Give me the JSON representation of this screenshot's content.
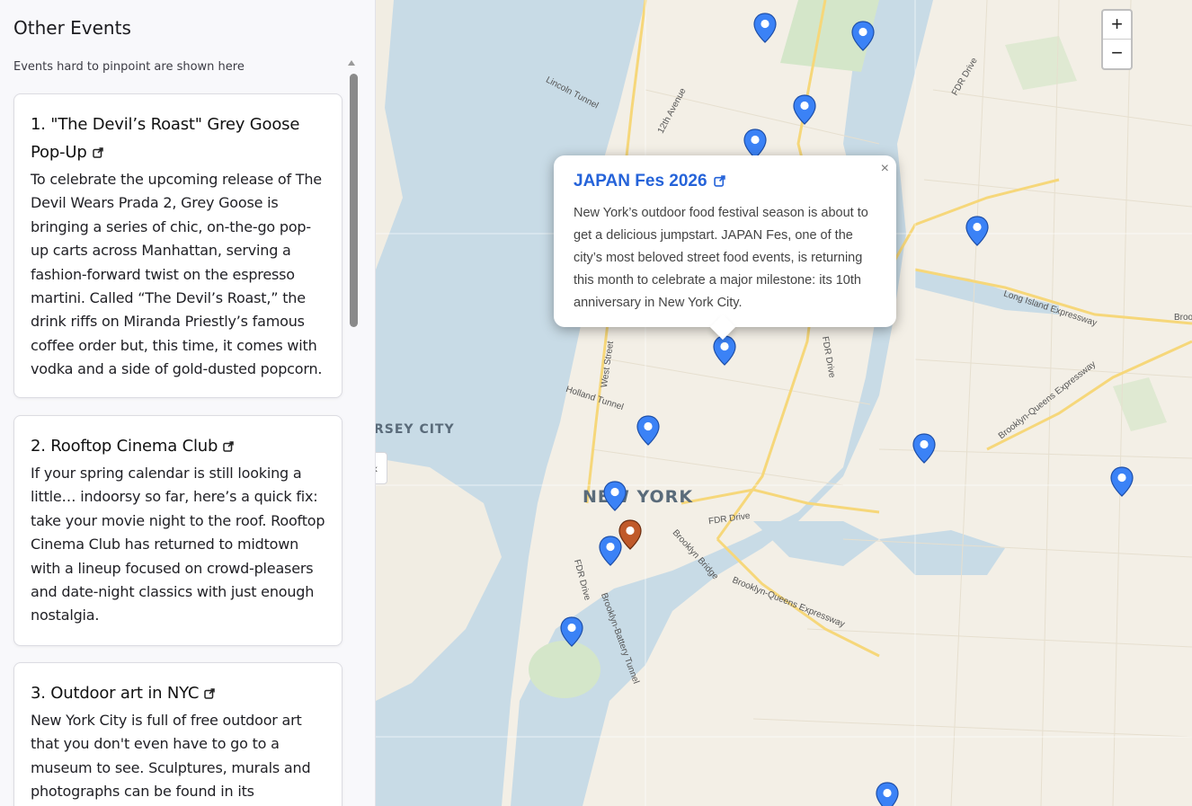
{
  "sidebar": {
    "title": "Other Events",
    "subtitle": "Events hard to pinpoint are shown here",
    "events": [
      {
        "title": "1. \"The Devil’s Roast\" Grey Goose Pop-Up",
        "body": "To celebrate the upcoming release of The Devil Wears Prada 2, Grey Goose is bringing a series of chic, on-the-go pop-up carts across Manhattan, serving a fashion-forward twist on the espresso martini. Called “The Devil’s Roast,” the drink riffs on Miranda Priestly’s famous coffee order but, this time, it comes with vodka and a side of gold-dusted popcorn."
      },
      {
        "title": "2. Rooftop Cinema Club",
        "body": "If your spring calendar is still looking a little… indoorsy so far, here’s a quick fix: take your movie night to the roof. Rooftop Cinema Club has returned to midtown with a lineup focused on crowd-pleasers and date-night classics with just enough nostalgia."
      },
      {
        "title": "3. Outdoor art in NYC",
        "body": "New York City is full of free outdoor art that you don't even have to go to a museum to see. Sculptures, murals and photographs can be found in its"
      }
    ]
  },
  "map": {
    "zoom_in": "+",
    "zoom_out": "−",
    "collapse": "‹",
    "labels": {
      "city": "NEW YORK",
      "jersey": "RSEY CITY",
      "lincoln_tunnel": "Lincoln Tunnel",
      "holland_tunnel": "Holland Tunnel",
      "west_street": "West Street",
      "twelfth_ave": "12th Avenue",
      "fdr_drive_north": "FDR Drive",
      "fdr_drive_mid": "FDR Drive",
      "fdr_drive_south": "FDR Drive",
      "fdr_drive_east": "FDR Drive",
      "li_expressway": "Long Island Expressway",
      "broo": "Broo",
      "bqe_north": "Brooklyn-Queens Expressway",
      "bqe_south": "Brooklyn-Queens Expressway",
      "brooklyn_bridge": "Brooklyn Bridge",
      "brooklyn_battery": "Brooklyn-Battery Tunnel"
    },
    "colors": {
      "pin_blue": "#3b82f6",
      "pin_highlight": "#c05a2a",
      "water": "#c8dbe6",
      "land": "#f3efe6",
      "park": "#d4e6c9"
    }
  },
  "popup": {
    "title": "JAPAN Fes 2026",
    "close": "×",
    "body": "New York’s outdoor food festival season is about to get a delicious jumpstart. JAPAN Fes, one of the city’s most beloved street food events, is returning this month to celebrate a major milestone: its 10th anniversary in New York City."
  }
}
